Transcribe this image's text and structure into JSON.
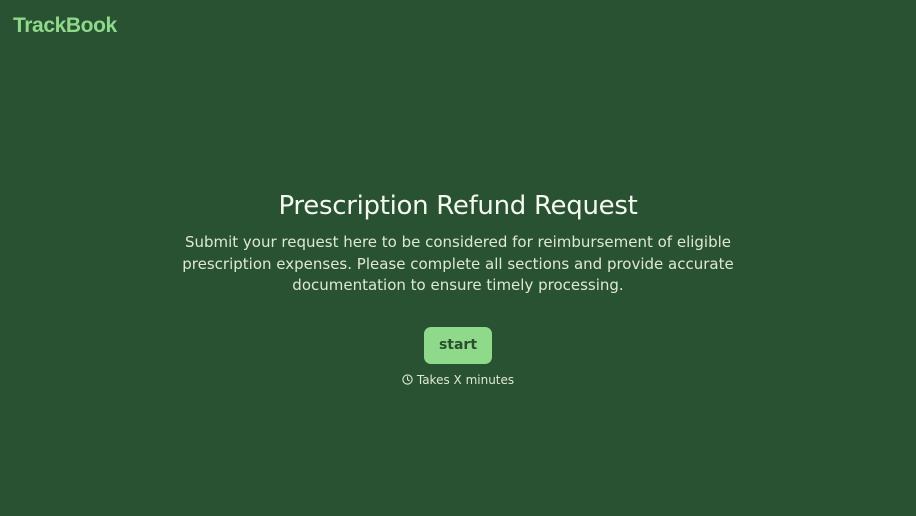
{
  "brand": {
    "name": "TrackBook",
    "color": "#8fd98a"
  },
  "hero": {
    "title": "Prescription Refund Request",
    "description": "Submit your request here to be considered for reimbursement of eligible prescription expenses. Please complete all sections and provide accurate documentation to ensure timely processing.",
    "start_label": "start",
    "duration_icon": "clock-icon",
    "duration_text": "Takes X minutes"
  },
  "colors": {
    "background": "#285232",
    "accent": "#8fd98a",
    "text": "#e4ecd8"
  }
}
